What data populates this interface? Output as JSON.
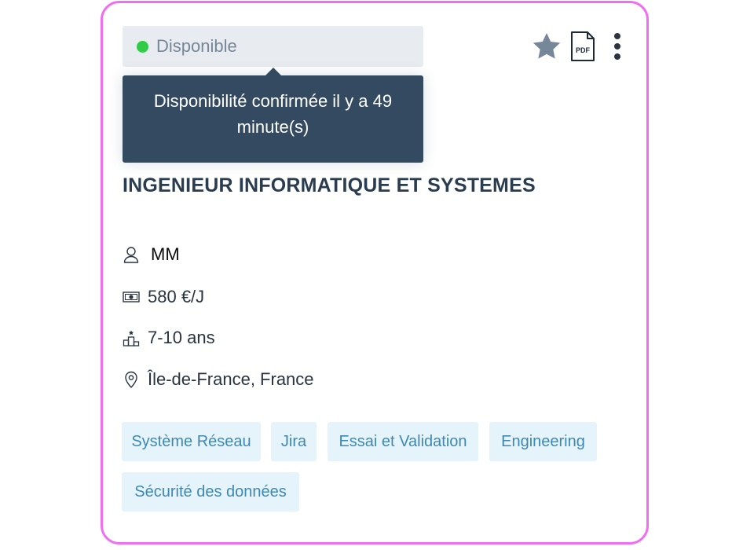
{
  "status": {
    "label": "Disponible",
    "dot_color": "#2fcc48",
    "tooltip": "Disponibilité confirmée il y a 49 minute(s)"
  },
  "actions": {
    "favorite_icon": "star-icon",
    "pdf_icon": "pdf-file-icon",
    "pdf_label": "PDF",
    "more_icon": "more-vertical-icon"
  },
  "profile": {
    "title": "INGENIEUR INFORMATIQUE ET SYSTEMES",
    "initials": "MM",
    "rate": "580 €/J",
    "experience": "7-10 ans",
    "location": "Île-de-France, France"
  },
  "skills": [
    "Système Réseau",
    "Jira",
    "Essai et Validation",
    "Engineering",
    "Sécurité des données"
  ],
  "colors": {
    "card_border": "#f06ef2",
    "tooltip_bg": "#344a61",
    "tag_bg": "#e5f3fa",
    "tag_text": "#3f88b3",
    "title_text": "#2a3c4f"
  }
}
